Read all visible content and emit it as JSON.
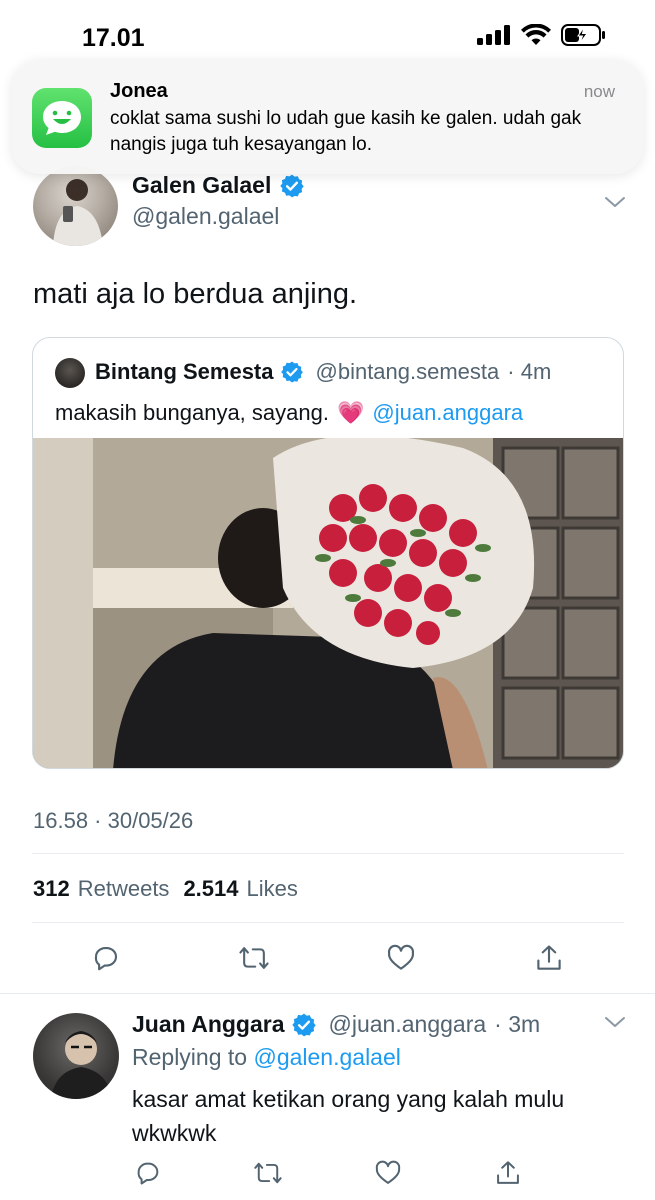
{
  "status_bar": {
    "time": "17.01"
  },
  "notification": {
    "app": "Jonea",
    "time": "now",
    "body": "coklat sama sushi lo udah gue kasih ke galen. udah gak nangis juga tuh kesayangan lo.",
    "icon": "chat-bubble-icon"
  },
  "tweet": {
    "author_name": "Galen Galael",
    "author_handle": "@galen.galael",
    "text": "mati aja lo berdua anjing.",
    "timestamp": "16.58 · 30/05/26",
    "retweets": "312",
    "retweets_label": "Retweets",
    "likes": "2.514",
    "likes_label": "Likes"
  },
  "quoted": {
    "author_name": "Bintang Semesta",
    "author_handle": "@bintang.semesta",
    "age": "· 4m",
    "text": "makasih bunganya, sayang.",
    "emoji": "💗",
    "mention": "@juan.anggara"
  },
  "reply": {
    "author_name": "Juan Anggara",
    "author_handle": "@juan.anggara",
    "age": "· 3m",
    "replying_label": "Replying to",
    "replying_to": "@galen.galael",
    "text": "kasar amat ketikan orang yang kalah mulu wkwkwk"
  },
  "colors": {
    "accent": "#1d9bf0",
    "muted": "#536471",
    "verified": "#1d9bf0"
  }
}
